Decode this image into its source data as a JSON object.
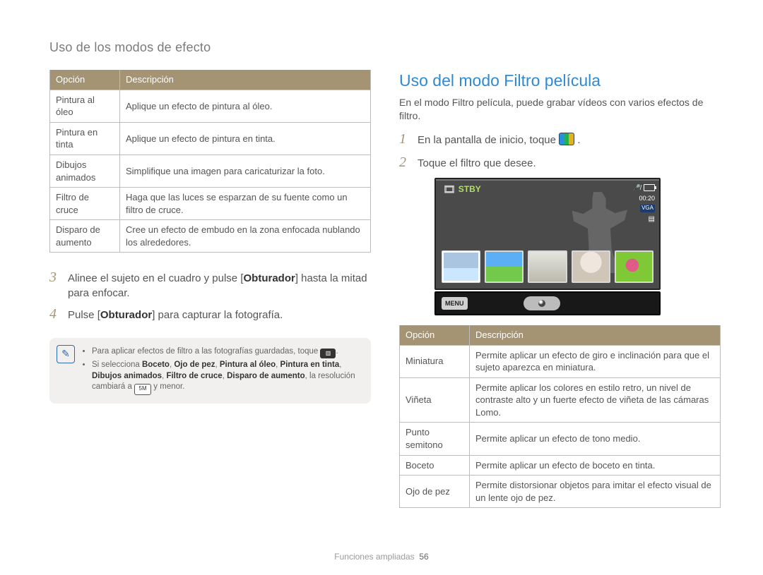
{
  "header": "Uso de los modos de efecto",
  "table1": {
    "head": {
      "c1": "Opción",
      "c2": "Descripción"
    },
    "rows": [
      {
        "opt": "Pintura al óleo",
        "desc": "Aplique un efecto de pintura al óleo."
      },
      {
        "opt": "Pintura en tinta",
        "desc": "Aplique un efecto de pintura en tinta."
      },
      {
        "opt": "Dibujos animados",
        "desc": "Simplifique una imagen para caricaturizar la foto."
      },
      {
        "opt": "Filtro de cruce",
        "desc": "Haga que las luces se esparzan de su fuente como un filtro de cruce."
      },
      {
        "opt": "Disparo de aumento",
        "desc": "Cree un efecto de embudo en la zona enfocada nublando los alrededores."
      }
    ]
  },
  "steps_left": {
    "3": {
      "a": "Alinee el sujeto en el cuadro y pulse [",
      "b": "Obturador",
      "c": "] hasta la mitad para enfocar."
    },
    "4": {
      "a": "Pulse [",
      "b": "Obturador",
      "c": "] para capturar la fotografía."
    }
  },
  "note": {
    "li1": "Para aplicar efectos de filtro a las fotografías guardadas, toque ",
    "li2a": "Si selecciona ",
    "li2b": "Boceto",
    "li2c": ", ",
    "li2d": "Ojo de pez",
    "li2e": ", ",
    "li2f": "Pintura al óleo",
    "li2g": ", ",
    "li2h": "Pintura en tinta",
    "li2i": ", ",
    "li2j": "Dibujos animados",
    "li2k": ", ",
    "li2l": "Filtro de cruce",
    "li2m": ", ",
    "li2n": "Disparo de aumento",
    "li2o": ", la resolución cambiará a ",
    "li2p": "5M",
    "li2q": " y menor."
  },
  "right": {
    "title": "Uso del modo Filtro película",
    "lead": "En el modo Filtro película, puede grabar vídeos con varios efectos de filtro.",
    "step1": "En la pantalla de inicio, toque ",
    "step1_end": ".",
    "step2": "Toque el filtro que desee."
  },
  "lcd": {
    "stby": "STBY",
    "time": "00:20",
    "vga": "VGA",
    "menu": "MENU"
  },
  "table2": {
    "head": {
      "c1": "Opción",
      "c2": "Descripción"
    },
    "rows": [
      {
        "opt": "Miniatura",
        "desc": "Permite aplicar un efecto de giro e inclinación para que el sujeto aparezca en miniatura."
      },
      {
        "opt": "Viñeta",
        "desc": "Permite aplicar los colores en estilo retro, un nivel de contraste alto y un fuerte efecto de viñeta de las cámaras Lomo."
      },
      {
        "opt": "Punto semitono",
        "desc": "Permite aplicar un efecto de tono medio."
      },
      {
        "opt": "Boceto",
        "desc": "Permite aplicar un efecto de boceto en tinta."
      },
      {
        "opt": "Ojo de pez",
        "desc": "Permite distorsionar objetos para imitar el efecto visual de un lente ojo de pez."
      }
    ]
  },
  "footer": {
    "section": "Funciones ampliadas",
    "page": "56"
  }
}
